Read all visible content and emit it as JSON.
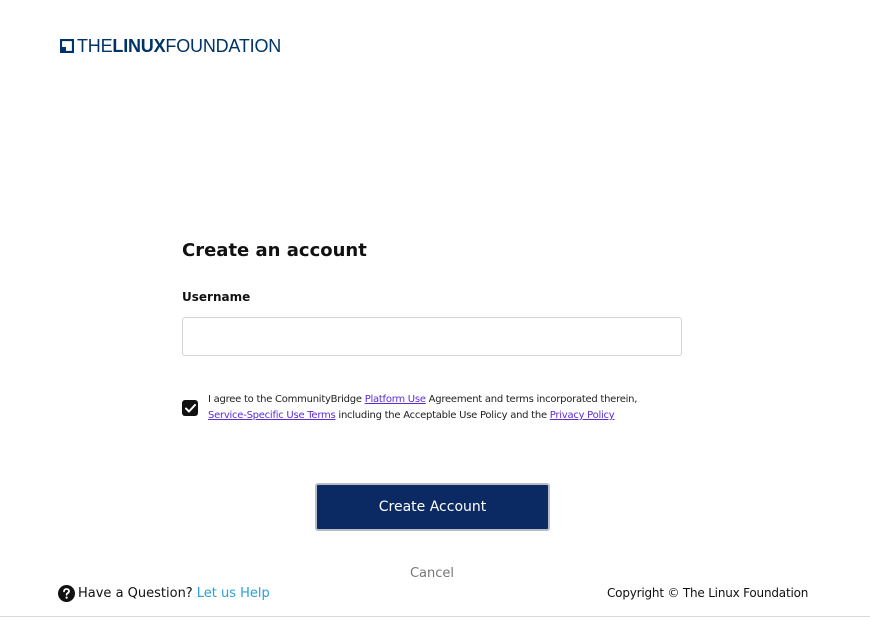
{
  "brand": {
    "logo_prefix": "THE",
    "logo_bold": "LINUX",
    "logo_suffix": "FOUNDATION",
    "color": "#003366"
  },
  "form": {
    "title": "Create an account",
    "username_label": "Username",
    "username_value": "",
    "username_placeholder": "",
    "agreement": {
      "checked": true,
      "text_1": "I agree to the CommunityBridge ",
      "link_platform_use": "Platform Use",
      "text_2": " Agreement and terms incorporated therein, ",
      "link_service_terms": "Service-Specific Use Terms",
      "text_3": " including the Acceptable Use Policy and the ",
      "link_privacy": "Privacy Policy"
    },
    "submit_label": "Create Account",
    "cancel_label": "Cancel"
  },
  "footer": {
    "help_text": "Have a Question?",
    "help_link": "Let us Help",
    "copyright": "Copyright © The Linux Foundation"
  },
  "colors": {
    "primary_button": "#0b2a63",
    "link": "#5b2bd9",
    "help_link": "#2a9fd8"
  },
  "icons": {
    "checkbox": "check-icon",
    "help": "question-circle-icon",
    "logo": "linux-foundation-logo-mark"
  }
}
